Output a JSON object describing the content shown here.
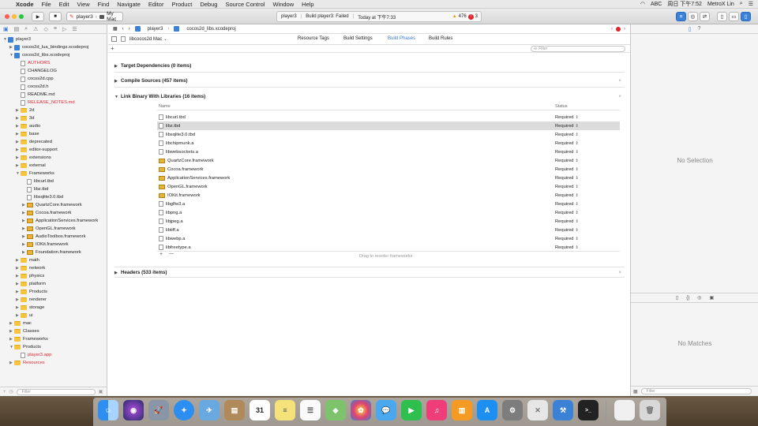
{
  "menubar": {
    "apple": "",
    "app": "Xcode",
    "items": [
      "File",
      "Edit",
      "View",
      "Find",
      "Navigate",
      "Editor",
      "Product",
      "Debug",
      "Source Control",
      "Window",
      "Help"
    ],
    "input_method": "ABC",
    "clock": "周日 下午7:52",
    "user": "MetroX Lin"
  },
  "toolbar": {
    "scheme": "player3",
    "destination": "My Mac",
    "activity_target": "player3",
    "activity_status": "Build player3: Failed",
    "activity_time": "Today at 下午7:33",
    "warnings": "476",
    "errors": "3"
  },
  "navigator": {
    "filter_placeholder": "Filter",
    "items": [
      {
        "label": "player3",
        "kind": "proj",
        "indent": 0,
        "open": true
      },
      {
        "label": "cocos2d_lua_bindings.xcodeproj",
        "kind": "proj",
        "indent": 1,
        "open": false
      },
      {
        "label": "cocos2d_libs.xcodeproj",
        "kind": "proj",
        "indent": 1,
        "open": true
      },
      {
        "label": "AUTHORS",
        "kind": "file",
        "indent": 2,
        "red": true
      },
      {
        "label": "CHANGELOG",
        "kind": "file",
        "indent": 2
      },
      {
        "label": "cocos2d.cpp",
        "kind": "file",
        "indent": 2
      },
      {
        "label": "cocos2d.h",
        "kind": "file",
        "indent": 2
      },
      {
        "label": "README.md",
        "kind": "file",
        "indent": 2
      },
      {
        "label": "RELEASE_NOTES.md",
        "kind": "file",
        "indent": 2,
        "red": true
      },
      {
        "label": "2d",
        "kind": "folder",
        "indent": 2
      },
      {
        "label": "3d",
        "kind": "folder",
        "indent": 2
      },
      {
        "label": "audio",
        "kind": "folder",
        "indent": 2
      },
      {
        "label": "base",
        "kind": "folder",
        "indent": 2
      },
      {
        "label": "deprecated",
        "kind": "folder",
        "indent": 2
      },
      {
        "label": "editor-support",
        "kind": "folder",
        "indent": 2
      },
      {
        "label": "extensions",
        "kind": "folder",
        "indent": 2
      },
      {
        "label": "external",
        "kind": "folder",
        "indent": 2
      },
      {
        "label": "Frameworks",
        "kind": "folder",
        "indent": 2,
        "open": true
      },
      {
        "label": "libcurl.tbd",
        "kind": "file",
        "indent": 3
      },
      {
        "label": "libz.tbd",
        "kind": "file",
        "indent": 3
      },
      {
        "label": "libsqlite3.0.tbd",
        "kind": "file",
        "indent": 3
      },
      {
        "label": "QuartzCore.framework",
        "kind": "fw",
        "indent": 3
      },
      {
        "label": "Cocoa.framework",
        "kind": "fw",
        "indent": 3
      },
      {
        "label": "ApplicationServices.framework",
        "kind": "fw",
        "indent": 3
      },
      {
        "label": "OpenGL.framework",
        "kind": "fw",
        "indent": 3
      },
      {
        "label": "AudioToolbox.framework",
        "kind": "fw",
        "indent": 3
      },
      {
        "label": "IOKit.framework",
        "kind": "fw",
        "indent": 3
      },
      {
        "label": "Foundation.framework",
        "kind": "fw",
        "indent": 3
      },
      {
        "label": "math",
        "kind": "folder",
        "indent": 2
      },
      {
        "label": "network",
        "kind": "folder",
        "indent": 2
      },
      {
        "label": "physics",
        "kind": "folder",
        "indent": 2
      },
      {
        "label": "platform",
        "kind": "folder",
        "indent": 2
      },
      {
        "label": "Products",
        "kind": "folder",
        "indent": 2
      },
      {
        "label": "renderer",
        "kind": "folder",
        "indent": 2
      },
      {
        "label": "storage",
        "kind": "folder",
        "indent": 2
      },
      {
        "label": "ui",
        "kind": "folder",
        "indent": 2
      },
      {
        "label": "mac",
        "kind": "folder",
        "indent": 1
      },
      {
        "label": "Classes",
        "kind": "folder",
        "indent": 1
      },
      {
        "label": "Frameworks",
        "kind": "folder",
        "indent": 1
      },
      {
        "label": "Products",
        "kind": "folder",
        "indent": 1,
        "open": true
      },
      {
        "label": "player3.app",
        "kind": "app",
        "indent": 2,
        "red": true
      },
      {
        "label": "Resources",
        "kind": "folder",
        "indent": 1,
        "red": true
      }
    ]
  },
  "editor": {
    "breadcrumb": [
      "player3",
      "cocos2d_libs.xcodeproj"
    ],
    "target": "libcocos2d Mac",
    "tabs": [
      "Resource Tags",
      "Build Settings",
      "Build Phases",
      "Build Rules"
    ],
    "active_tab": "Build Phases",
    "filter_placeholder": "Filter",
    "phases": {
      "target_deps": "Target Dependencies (0 items)",
      "compile_sources": "Compile Sources (457 items)",
      "link_binary": "Link Binary With Libraries (16 items)",
      "headers": "Headers (533 items)"
    },
    "columns": {
      "name": "Name",
      "status": "Status"
    },
    "libraries": [
      {
        "name": "libcurl.tbd",
        "kind": "file",
        "status": "Required"
      },
      {
        "name": "libz.tbd",
        "kind": "file",
        "status": "Required",
        "selected": true
      },
      {
        "name": "libsqlite3.0.tbd",
        "kind": "file",
        "status": "Required"
      },
      {
        "name": "libchipmunk.a",
        "kind": "file",
        "status": "Required"
      },
      {
        "name": "libwebsockets.a",
        "kind": "file",
        "status": "Required"
      },
      {
        "name": "QuartzCore.framework",
        "kind": "fw",
        "status": "Required"
      },
      {
        "name": "Cocoa.framework",
        "kind": "fw",
        "status": "Required"
      },
      {
        "name": "ApplicationServices.framework",
        "kind": "fw",
        "status": "Required"
      },
      {
        "name": "OpenGL.framework",
        "kind": "fw",
        "status": "Required"
      },
      {
        "name": "IOKit.framework",
        "kind": "fw",
        "status": "Required"
      },
      {
        "name": "libglfw3.a",
        "kind": "file",
        "status": "Required"
      },
      {
        "name": "libpng.a",
        "kind": "file",
        "status": "Required"
      },
      {
        "name": "libjpeg.a",
        "kind": "file",
        "status": "Required"
      },
      {
        "name": "libtiff.a",
        "kind": "file",
        "status": "Required"
      },
      {
        "name": "libwebp.a",
        "kind": "file",
        "status": "Required"
      },
      {
        "name": "libfreetype.a",
        "kind": "file",
        "status": "Required"
      }
    ],
    "add": "+",
    "remove": "—",
    "drag_hint": "Drag to reorder frameworks"
  },
  "inspector": {
    "no_selection": "No Selection",
    "no_matches": "No Matches",
    "filter_placeholder": "Filter"
  }
}
